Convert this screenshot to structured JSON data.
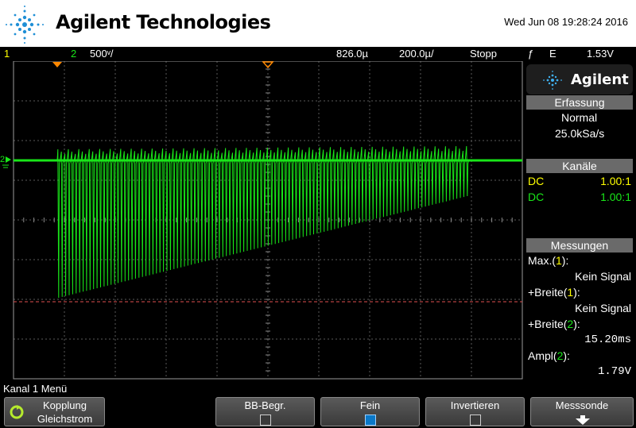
{
  "header": {
    "brand": "Agilent Technologies",
    "datetime": "Wed Jun 08 19:28:24 2016"
  },
  "status": {
    "ch1_number": "1",
    "ch2_number": "2",
    "ch2_scale": "500ᵛ/",
    "trigger_pos": "826.0µ",
    "timebase": "200.0µ/",
    "run_state": "Stopp",
    "trigger_slope": "ƒ",
    "trigger_source": "E",
    "trigger_level": "1.53V"
  },
  "side": {
    "logo": "Agilent",
    "acq_title": "Erfassung",
    "acq_mode": "Normal",
    "acq_rate": "25.0kSa/s",
    "channels_title": "Kanäle",
    "channels": [
      {
        "coupling": "DC",
        "ratio": "1.00:1"
      },
      {
        "coupling": "DC",
        "ratio": "1.00:1"
      }
    ],
    "meas_title": "Messungen",
    "meas": [
      {
        "label_pre": "Max.(",
        "ch": "1",
        "label_post": "):",
        "value": "Kein Signal"
      },
      {
        "label_pre": "+Breite(",
        "ch": "1",
        "label_post": "):",
        "value": "Kein Signal"
      },
      {
        "label_pre": "+Breite(",
        "ch": "2",
        "label_post": "):",
        "value": "15.20ms"
      },
      {
        "label_pre": "Ampl(",
        "ch": "2",
        "label_post": "):",
        "value": "1.79V"
      }
    ]
  },
  "menu": {
    "title": "Kanal 1 Menü",
    "keys": [
      {
        "line1": "Kopplung",
        "line2": "Gleichstrom"
      },
      {
        "line1": "BB-Begr."
      },
      {
        "line1": "Fein"
      },
      {
        "line1": "Invertieren"
      },
      {
        "line1": "Messsonde"
      }
    ]
  },
  "colors": {
    "ch1": "#ffff00",
    "ch2": "#19e619",
    "trigger_marker": "#ff8800",
    "ref_line": "#e05050"
  }
}
